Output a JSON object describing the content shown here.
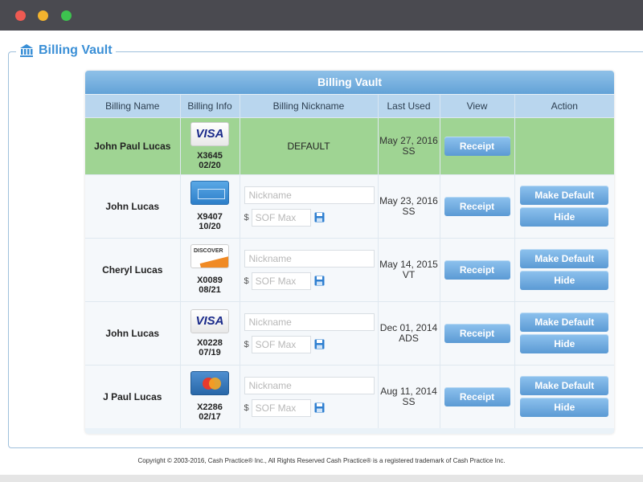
{
  "window": {
    "controls": [
      "close",
      "minimize",
      "maximize"
    ]
  },
  "section_title": "Billing Vault",
  "panel_title": "Billing Vault",
  "columns": [
    "Billing Name",
    "Billing Info",
    "Billing Nickname",
    "Last Used",
    "View",
    "Action"
  ],
  "placeholders": {
    "nickname": "Nickname",
    "sof": "SOF Max"
  },
  "currency_symbol": "$",
  "buttons": {
    "receipt": "Receipt",
    "make_default": "Make Default",
    "hide": "Hide"
  },
  "rows": [
    {
      "name": "John Paul Lucas",
      "card_icon": "visa-card-icon",
      "card_brand": "VISA",
      "card_number": "X3645",
      "card_exp": "02/20",
      "nickname": "DEFAULT",
      "last_used_date": "May 27, 2016",
      "last_used_by": "SS",
      "is_default": true
    },
    {
      "name": "John Lucas",
      "card_icon": "amex-card-icon",
      "card_number": "X9407",
      "card_exp": "10/20",
      "last_used_date": "May 23, 2016",
      "last_used_by": "SS",
      "is_default": false
    },
    {
      "name": "Cheryl Lucas",
      "card_icon": "discover-card-icon",
      "card_brand": "DISCOVER",
      "card_number": "X0089",
      "card_exp": "08/21",
      "last_used_date": "May 14, 2015",
      "last_used_by": "VT",
      "is_default": false
    },
    {
      "name": "John Lucas",
      "card_icon": "visa-card-icon",
      "card_brand": "VISA",
      "card_number": "X0228",
      "card_exp": "07/19",
      "last_used_date": "Dec 01, 2014",
      "last_used_by": "ADS",
      "is_default": false
    },
    {
      "name": "J Paul Lucas",
      "card_icon": "mastercard-card-icon",
      "card_number": "X2286",
      "card_exp": "02/17",
      "last_used_date": "Aug 11, 2014",
      "last_used_by": "SS",
      "is_default": false
    }
  ],
  "footer": "Copyright © 2003-2016, Cash Practice® Inc., All Rights Reserved Cash Practice® is a registered trademark of Cash Practice Inc.",
  "colors": {
    "default_row": "#9fd493",
    "accent": "#3a8fd6",
    "header": "#b9d6ee",
    "button": "#6fa9dc"
  }
}
